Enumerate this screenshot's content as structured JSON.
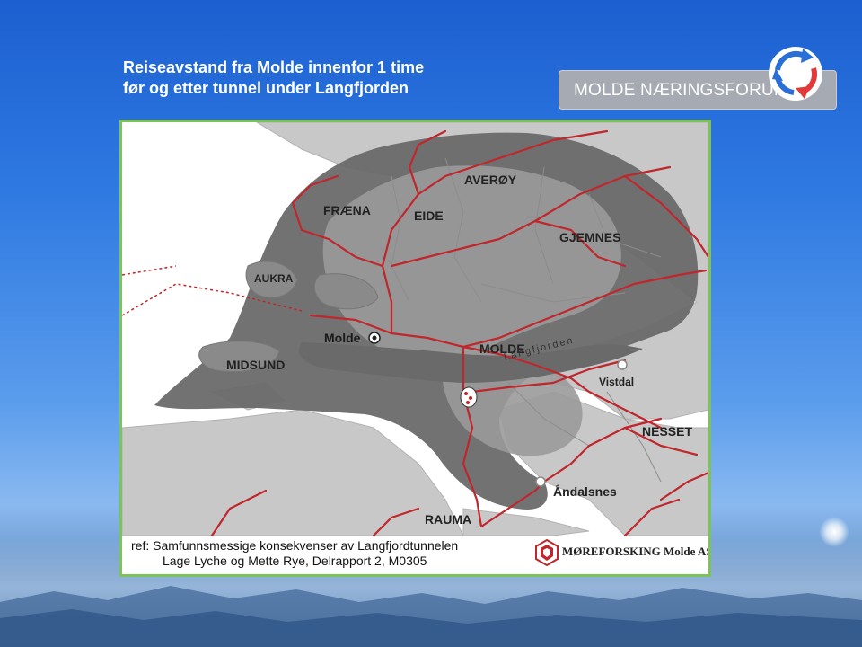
{
  "title": {
    "line1": "Reiseavstand fra Molde innenfor 1 time",
    "line2": "før og etter tunnel under Langfjorden"
  },
  "logo": {
    "text": "MOLDE NÆRINGSFORUM",
    "colors": {
      "blue": "#2a6fd6",
      "red": "#e23a3a",
      "grey": "#a6aab2"
    }
  },
  "map": {
    "labels": {
      "averoy": "AVERØY",
      "fraena": "FRÆNA",
      "eide": "EIDE",
      "gjemnes": "GJEMNES",
      "aukra": "AUKRA",
      "molde_town": "Molde",
      "molde_muni": "MOLDE",
      "midsund": "MIDSUND",
      "langfjorden": "Langfjorden",
      "vistdal": "Vistdal",
      "nesset": "NESSET",
      "andalsnes": "Åndalsnes",
      "rauma": "RAUMA"
    },
    "colors": {
      "road": "#c0262b",
      "zone_outer": "#6a6a6a",
      "zone_inner": "#9a9a9a",
      "land": "#c8c8c8",
      "border": "#7cc35a"
    },
    "reference": {
      "line1": "ref: Samfunnsmessige konsekvenser av Langfjordtunnelen",
      "line2": "Lage Lyche og Mette Rye, Delrapport 2, M0305"
    },
    "publisher": "MØREFORSKING Molde AS"
  }
}
